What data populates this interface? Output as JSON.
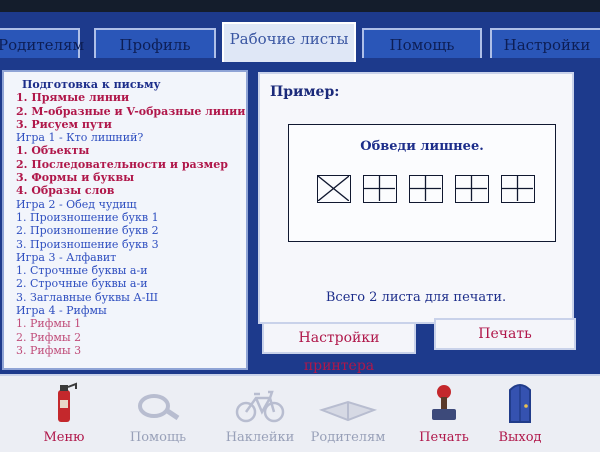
{
  "tabs": [
    {
      "label": "Родителям",
      "active": false
    },
    {
      "label": "Профиль",
      "active": false
    },
    {
      "label": "Рабочие листы",
      "active": true
    },
    {
      "label": "Помощь",
      "active": false
    },
    {
      "label": "Настройки",
      "active": false
    }
  ],
  "worksheet_list": [
    {
      "label": "Подготовка к письму",
      "style": "head"
    },
    {
      "label": "1. Прямые линии",
      "style": "red"
    },
    {
      "label": "2. M-образные и V-образные линии",
      "style": "red"
    },
    {
      "label": "3. Рисуем пути",
      "style": "red"
    },
    {
      "label": "Игра 1 - Кто лишний?",
      "style": "blue"
    },
    {
      "label": "1. Объекты",
      "style": "red"
    },
    {
      "label": "2. Последовательности и размер",
      "style": "red"
    },
    {
      "label": "3. Формы и буквы",
      "style": "red"
    },
    {
      "label": "4. Образы слов",
      "style": "red"
    },
    {
      "label": "Игра 2 - Обед чудищ",
      "style": "blue"
    },
    {
      "label": "1. Произношение букв 1",
      "style": "blue"
    },
    {
      "label": "2. Произношение букв 2",
      "style": "blue"
    },
    {
      "label": "3. Произношение букв 3",
      "style": "blue"
    },
    {
      "label": "Игра 3 - Алфавит",
      "style": "blue"
    },
    {
      "label": "1. Строчные буквы а-и",
      "style": "blue"
    },
    {
      "label": "2. Строчные буквы а-и",
      "style": "blue"
    },
    {
      "label": "3. Заглавные буквы А-Ш",
      "style": "blue"
    },
    {
      "label": "Игра 4 - Рифмы",
      "style": "blue"
    },
    {
      "label": "1. Рифмы 1",
      "style": "pink"
    },
    {
      "label": "2. Рифмы 2",
      "style": "pink"
    },
    {
      "label": "3. Рифмы 3",
      "style": "pink"
    }
  ],
  "preview": {
    "label": "Пример:",
    "example_title": "Обведи лишнее.",
    "print_count": "Всего 2 листа для печати."
  },
  "buttons": {
    "printer_settings": "Настройки принтера",
    "print": "Печать"
  },
  "toolbar": [
    {
      "label": "Меню",
      "icon": "fire-extinguisher-icon"
    },
    {
      "label": "Помощь",
      "icon": "magnifier-icon"
    },
    {
      "label": "Наклейки",
      "icon": "bicycle-icon"
    },
    {
      "label": "Родителям",
      "icon": "book-icon"
    },
    {
      "label": "Печать",
      "icon": "stamp-icon"
    },
    {
      "label": "Выход",
      "icon": "door-icon"
    }
  ],
  "colors": {
    "background": "#1d3a8c",
    "active_tab": "#dfe7f6",
    "accent_red": "#b0174a",
    "text_navy": "#1c2d8a"
  }
}
